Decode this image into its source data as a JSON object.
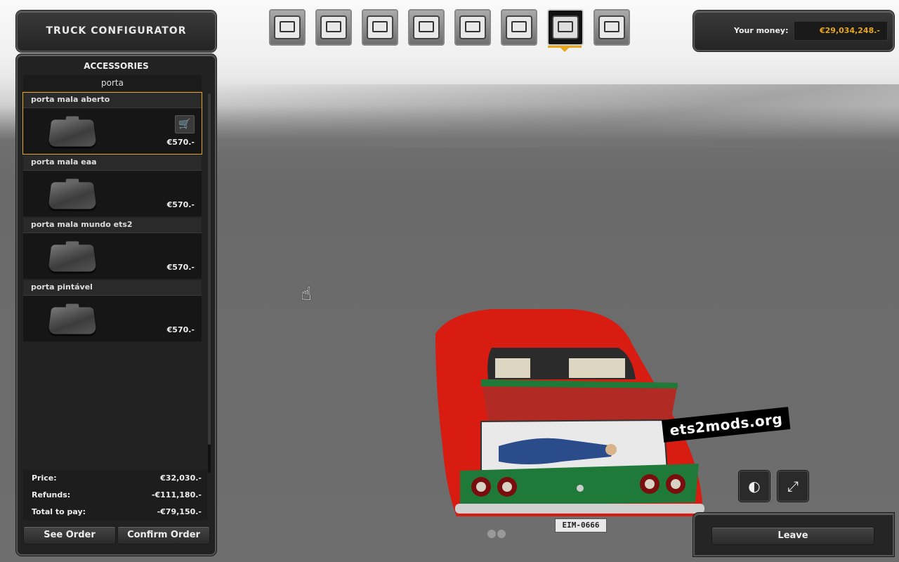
{
  "window": {
    "title": "TRUCK CONFIGURATOR"
  },
  "tabs": [
    {
      "name": "cabin-tab",
      "icon": "truck-cabin-icon",
      "active": false
    },
    {
      "name": "chassis-tab",
      "icon": "chassis-icon",
      "active": false
    },
    {
      "name": "engine-tab",
      "icon": "engine-icon",
      "active": false
    },
    {
      "name": "transmission-tab",
      "icon": "transmission-icon",
      "active": false
    },
    {
      "name": "interior-tab",
      "icon": "interior-icon",
      "active": false
    },
    {
      "name": "paint-tab",
      "icon": "paint-icon",
      "active": false
    },
    {
      "name": "accessories-tab",
      "icon": "accessories-icon",
      "active": true
    },
    {
      "name": "interior-accessories-tab",
      "icon": "interior-accessories-icon",
      "active": false
    }
  ],
  "money": {
    "label": "Your money:",
    "value": "€29,034,248.-",
    "color": "#e8a61a"
  },
  "accessories": {
    "section_title": "ACCESSORIES",
    "category": "porta",
    "items": [
      {
        "name": "porta mala aberto",
        "price": "€570.-",
        "selected": true
      },
      {
        "name": "porta mala eaa",
        "price": "€570.-",
        "selected": false
      },
      {
        "name": "porta mala mundo ets2",
        "price": "€570.-",
        "selected": false
      },
      {
        "name": "porta pintável",
        "price": "€570.-",
        "selected": false
      }
    ]
  },
  "totals": {
    "price_label": "Price:",
    "price_value": "€32,030.-",
    "refunds_label": "Refunds:",
    "refunds_value": "-€111,180.-",
    "total_label": "Total to pay:",
    "total_value": "-€79,150.-"
  },
  "buttons": {
    "see_order": "See Order",
    "confirm_order": "Confirm Order",
    "leave": "Leave"
  },
  "view_controls": {
    "lights_icon": "headlights-icon",
    "fullscreen_icon": "fullscreen-icon"
  },
  "scene": {
    "license_plate": "EIM-0666",
    "watermark": "ets2mods.org"
  },
  "colors": {
    "accent": "#e8a61a",
    "car_body": "#d81c12",
    "car_trim": "#1f7a3a"
  }
}
